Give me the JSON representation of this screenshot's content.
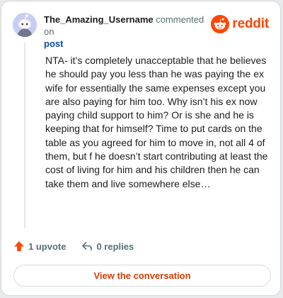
{
  "header": {
    "username": "The_Amazing_Username",
    "action_text": "commented on",
    "post_link": "post"
  },
  "brand": {
    "wordmark": "reddit",
    "icon": "reddit-alien-icon",
    "color": "#ff4500"
  },
  "comment": {
    "body": "NTA- it’s completely unacceptable that he believes he should pay you less than he was paying the ex wife for essentially the same expenses except you are also paying for him too. Why isn’t his ex now paying child support to him? Or is she and he is keeping that for himself? Time to put cards on the table as you agreed for him to move in, not all 4 of them, but f he doesn’t start contributing at least the cost of living for him and his children then he can take them and live somewhere else…"
  },
  "actions": {
    "upvote_label": "1 upvote",
    "upvote_icon": "upvote-arrow-icon",
    "reply_label": "0 replies",
    "reply_icon": "reply-arrow-icon"
  },
  "cta": {
    "label": "View the conversation"
  },
  "colors": {
    "accent": "#ff4500",
    "cta_text": "#d93a00",
    "link": "#0b4aa2",
    "avatar_bg": "#c9cdf2"
  }
}
